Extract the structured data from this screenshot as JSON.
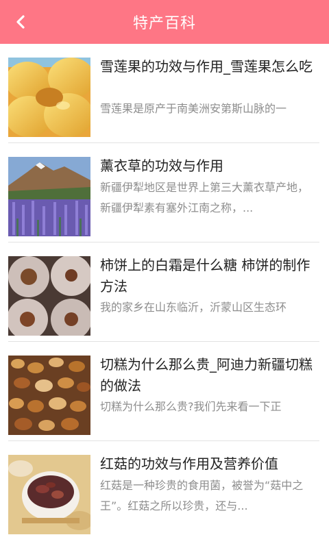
{
  "header": {
    "title": "特产百科",
    "back_icon": "chevron-left-icon"
  },
  "colors": {
    "header_bg": "#fe7685",
    "title_text": "#222222",
    "desc_text": "#8d8d8d"
  },
  "articles": [
    {
      "title": "雪莲果的功效与作用_雪莲果怎么吃",
      "desc": "雪莲果是原产于南美洲安第斯山脉的一",
      "image": "yacon-fruit-photo"
    },
    {
      "title": "薰衣草的功效与作用",
      "desc": "新疆伊犁地区是世界上第三大薰衣草产地，新疆伊犁素有塞外江南之称，...",
      "image": "lavender-field-photo"
    },
    {
      "title": "柿饼上的白霜是什么糖 柿饼的制作方法",
      "desc": "我的家乡在山东临沂，沂蒙山区生态环",
      "image": "dried-persimmon-photo"
    },
    {
      "title": "切糕为什么那么贵_阿迪力新疆切糕的做法",
      "desc": "切糕为什么那么贵?我们先来看一下正",
      "image": "nut-cake-photo"
    },
    {
      "title": "红菇的功效与作用及营养价值",
      "desc": "红菇是一种珍贵的食用菌，被誉为“菇中之王”。红菇之所以珍贵，还与...",
      "image": "red-mushroom-soup-photo"
    }
  ]
}
